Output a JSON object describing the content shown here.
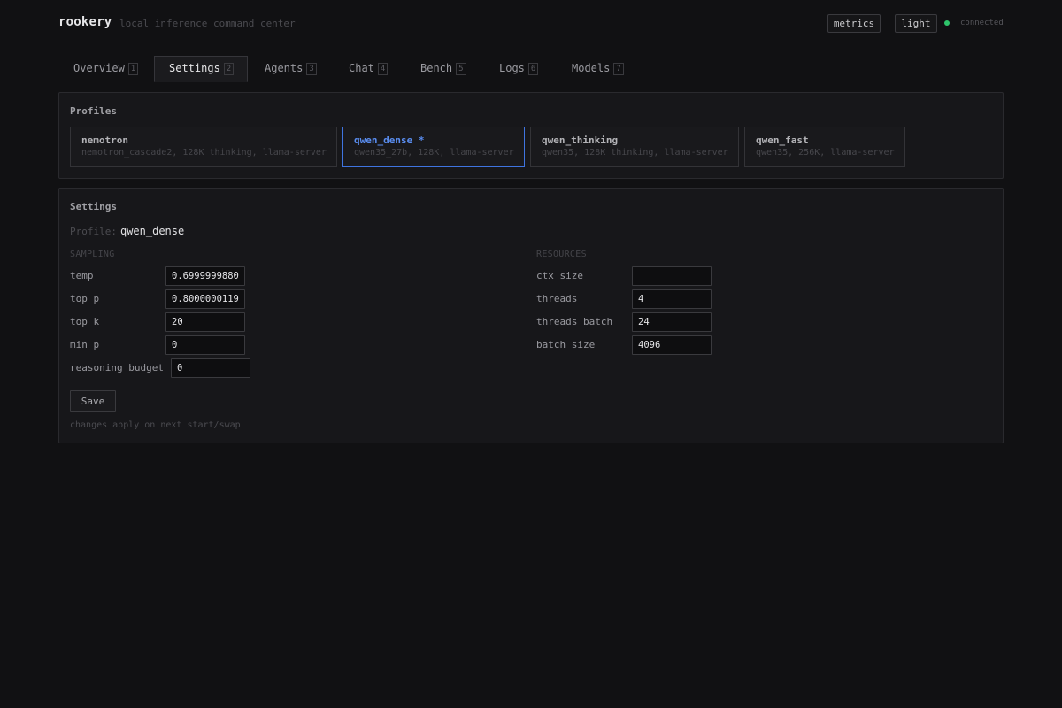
{
  "header": {
    "brand": "rookery",
    "tagline": "local inference command center",
    "metrics_label": "metrics",
    "theme_label": "light",
    "status_text": "connected",
    "status_color": "#2ec46a"
  },
  "tabs": [
    {
      "label": "Overview",
      "key": "1",
      "active": false
    },
    {
      "label": "Settings",
      "key": "2",
      "active": true
    },
    {
      "label": "Agents",
      "key": "3",
      "active": false
    },
    {
      "label": "Chat",
      "key": "4",
      "active": false
    },
    {
      "label": "Bench",
      "key": "5",
      "active": false
    },
    {
      "label": "Logs",
      "key": "6",
      "active": false
    },
    {
      "label": "Models",
      "key": "7",
      "active": false
    }
  ],
  "profiles": {
    "title": "Profiles",
    "items": [
      {
        "name": "nemotron",
        "desc": "nemotron_cascade2, 128K thinking, llama-server",
        "selected": false
      },
      {
        "name": "qwen_dense *",
        "desc": "qwen35_27b, 128K, llama-server",
        "selected": true
      },
      {
        "name": "qwen_thinking",
        "desc": "qwen35, 128K thinking, llama-server",
        "selected": false
      },
      {
        "name": "qwen_fast",
        "desc": "qwen35, 256K, llama-server",
        "selected": false
      }
    ]
  },
  "settings": {
    "title": "Settings",
    "profile_label": "Profile:",
    "profile_value": "qwen_dense",
    "sampling": {
      "heading": "SAMPLING",
      "fields": [
        {
          "label": "temp",
          "value": "0.699999988079071"
        },
        {
          "label": "top_p",
          "value": "0.800000011920929"
        },
        {
          "label": "top_k",
          "value": "20"
        },
        {
          "label": "min_p",
          "value": "0"
        },
        {
          "label": "reasoning_budget",
          "value": "0"
        }
      ]
    },
    "resources": {
      "heading": "RESOURCES",
      "fields": [
        {
          "label": "ctx_size",
          "value": ""
        },
        {
          "label": "threads",
          "value": "4"
        },
        {
          "label": "threads_batch",
          "value": "24"
        },
        {
          "label": "batch_size",
          "value": "4096"
        }
      ]
    },
    "save_label": "Save",
    "note": "changes apply on next start/swap"
  },
  "colors": {
    "accent": "#3f74e0",
    "background": "#111113"
  }
}
